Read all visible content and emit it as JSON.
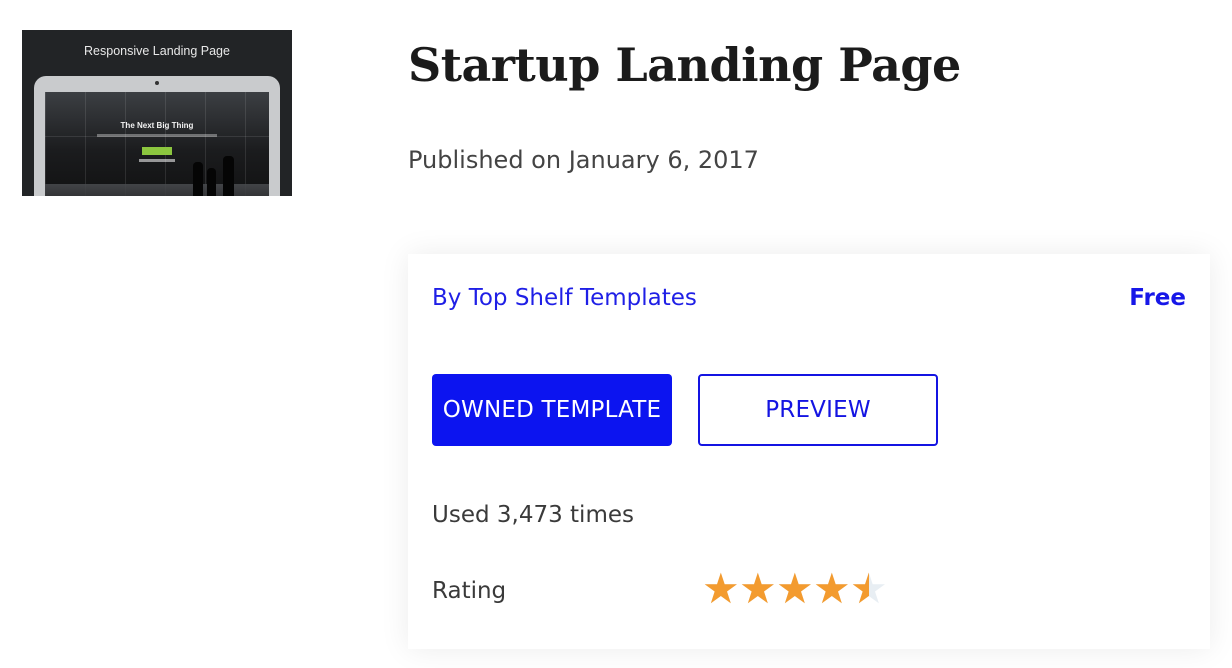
{
  "thumbnail": {
    "heading": "Responsive Landing Page",
    "screen_title": "The Next Big Thing"
  },
  "template": {
    "title": "Startup Landing Page",
    "published": "Published on January 6, 2017"
  },
  "card": {
    "author": "By Top Shelf Templates",
    "price": "Free",
    "owned_button": "OWNED TEMPLATE",
    "preview_button": "PREVIEW",
    "usage": "Used 3,473 times",
    "rating_label": "Rating",
    "rating_value": 4.5,
    "rating_max": 5
  },
  "colors": {
    "accent": "#0c14f0",
    "link": "#1f1fe6",
    "star_filled": "#f39b2f",
    "star_empty": "#e8eef3"
  }
}
